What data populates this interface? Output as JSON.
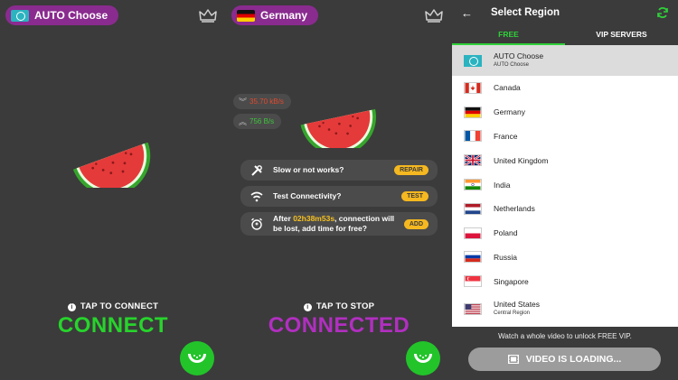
{
  "screen_connect": {
    "region_label": "AUTO Choose",
    "tap_hint": "TAP TO CONNECT",
    "status": "CONNECT"
  },
  "screen_connected": {
    "region_label": "Germany",
    "download_speed": "35.70 kB/s",
    "upload_speed": "756 B/s",
    "cards": [
      {
        "text": "Slow or not works?",
        "action": "REPAIR"
      },
      {
        "text": "Test Connectivity?",
        "action": "TEST"
      },
      {
        "time": "02h38m53s",
        "text_before": "After ",
        "text_after": ", connection will be lost, add time for free?",
        "action": "ADD"
      }
    ],
    "tap_hint": "TAP TO STOP",
    "status": "CONNECTED"
  },
  "screen_region": {
    "title": "Select Region",
    "tabs": [
      {
        "label": "FREE"
      },
      {
        "label": "VIP SERVERS"
      }
    ],
    "regions": [
      {
        "name": "AUTO Choose",
        "sub": "AUTO Choose",
        "flag": "globe"
      },
      {
        "name": "Canada",
        "flag": "ca"
      },
      {
        "name": "Germany",
        "flag": "de"
      },
      {
        "name": "France",
        "flag": "fr"
      },
      {
        "name": "United Kingdom",
        "flag": "uk"
      },
      {
        "name": "India",
        "flag": "in"
      },
      {
        "name": "Netherlands",
        "flag": "nl"
      },
      {
        "name": "Poland",
        "flag": "pl"
      },
      {
        "name": "Russia",
        "flag": "ru"
      },
      {
        "name": "Singapore",
        "flag": "sg"
      },
      {
        "name": "United States",
        "sub": "Central Region",
        "flag": "us"
      }
    ],
    "unlock_message": "Watch a whole video to unlock FREE VIP.",
    "video_button": "VIDEO IS LOADING..."
  },
  "colors": {
    "accent_purple": "#8a2b8f",
    "connect_green": "#27d42c",
    "connected_purple": "#b12fc0",
    "tab_active": "#2fd13a",
    "pill_yellow": "#f5b820"
  }
}
